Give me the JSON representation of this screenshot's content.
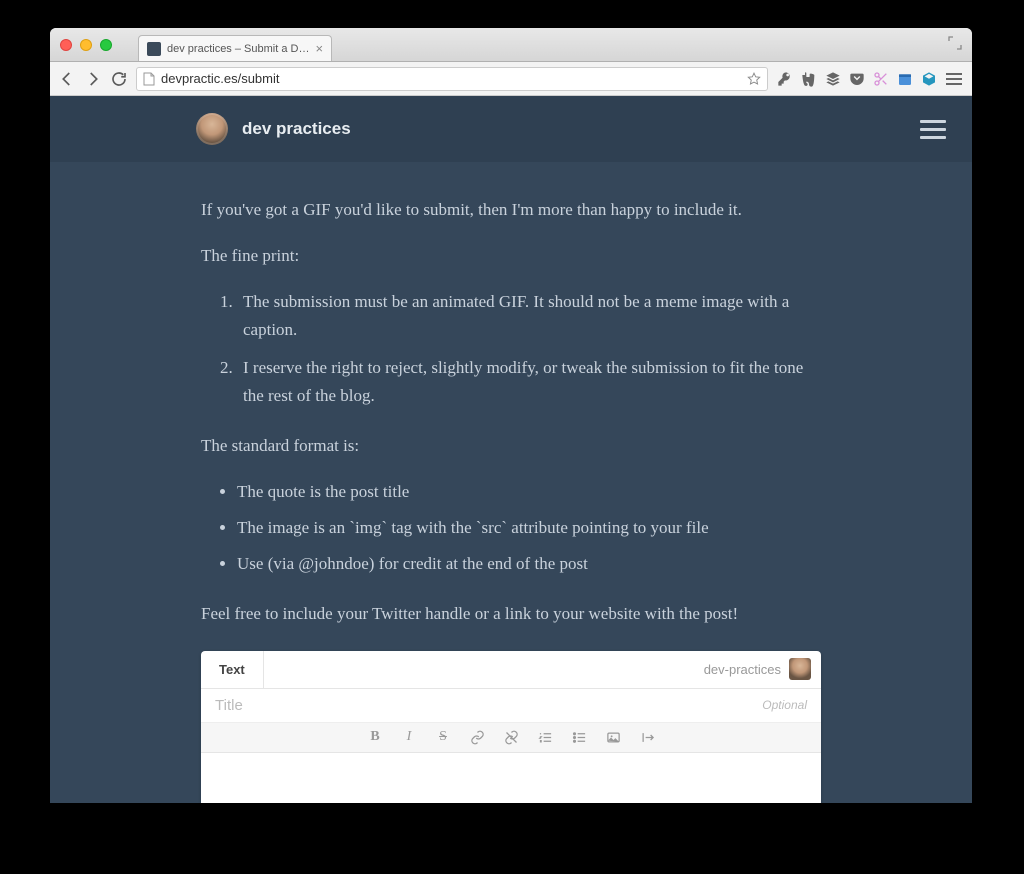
{
  "browser": {
    "tab_title": "dev practices – Submit a D…",
    "url_display": "devpractic.es/submit"
  },
  "site": {
    "title": "dev practices"
  },
  "content": {
    "intro": "If you've got a GIF you'd like to submit, then I'm more than happy to include it.",
    "fine_print_label": "The fine print:",
    "rules": [
      "The submission must be an animated GIF. It should not be a meme image with a caption.",
      "I reserve the right to reject, slightly modify, or tweak the submission to fit the tone the rest of the blog."
    ],
    "format_label": "The standard format is:",
    "format_items": [
      "The quote is the post title",
      "The image is an `img` tag with the `src` attribute pointing to your file",
      "Use (via @johndoe) for credit at the end of the post"
    ],
    "footer_note": "Feel free to include your Twitter handle or a link to your website with the post!"
  },
  "editor": {
    "tab_label": "Text",
    "username": "dev-practices",
    "title_placeholder": "Title",
    "optional_label": "Optional"
  }
}
